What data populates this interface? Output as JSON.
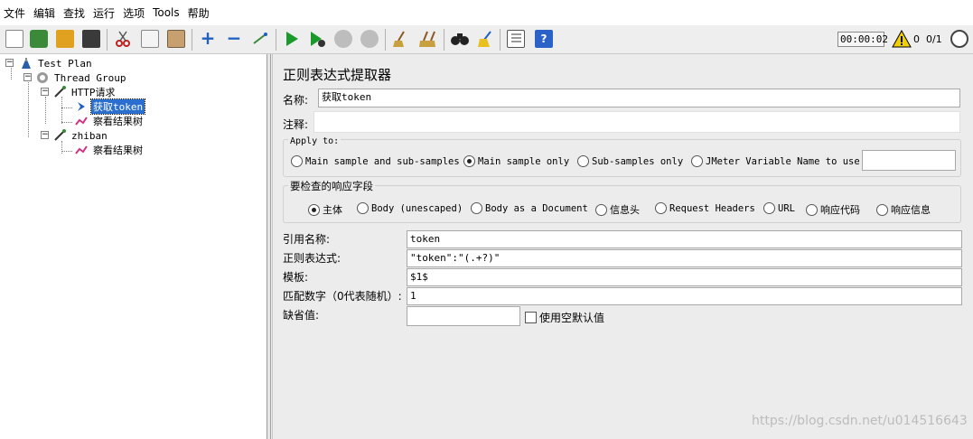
{
  "menu": [
    "文件",
    "编辑",
    "查找",
    "运行",
    "选项",
    "Tools",
    "帮助"
  ],
  "toolbar": {
    "icons": [
      "new-icon",
      "templates-icon",
      "open-icon",
      "save-icon",
      "cut-icon",
      "copy-icon",
      "paste-icon",
      "expand-icon",
      "collapse-icon",
      "toggle-icon",
      "start-icon",
      "start-no-pause-icon",
      "stop-icon",
      "shutdown-icon",
      "clear-icon",
      "clear-all-icon",
      "search-icon",
      "reset-search-icon",
      "function-helper-icon",
      "help-icon"
    ],
    "timer": "00:00:02",
    "warning_count": "0",
    "threads": "0/1"
  },
  "tree": {
    "items": [
      {
        "label": "Test Plan"
      },
      {
        "label": "Thread Group"
      },
      {
        "label": "HTTP请求"
      },
      {
        "label": "获取token"
      },
      {
        "label": "察看结果树"
      },
      {
        "label": "zhiban"
      },
      {
        "label": "察看结果树"
      }
    ]
  },
  "panel": {
    "title": "正则表达式提取器",
    "name_label": "名称:",
    "name_value": "获取token",
    "comment_label": "注释:",
    "comment_value": "",
    "apply_to": {
      "label": "Apply to:",
      "options": [
        "Main sample and sub-samples",
        "Main sample only",
        "Sub-samples only",
        "JMeter Variable Name to use"
      ],
      "selected": "Main sample only",
      "variable_value": ""
    },
    "field_to_check": {
      "label": "要检查的响应字段",
      "options": [
        "主体",
        "Body (unescaped)",
        "Body as a Document",
        "信息头",
        "Request Headers",
        "URL",
        "响应代码",
        "响应信息"
      ],
      "selected": "主体"
    },
    "ref_name_label": "引用名称:",
    "ref_name_value": "token",
    "regex_label": "正则表达式:",
    "regex_value": "\"token\":\"(.+?)\"",
    "template_label": "模板:",
    "template_value": "$1$",
    "match_no_label": "匹配数字（0代表随机）:",
    "match_no_value": "1",
    "default_label": "缺省值:",
    "default_value": "",
    "use_empty_default_label": "使用空默认值"
  },
  "watermark": "https://blog.csdn.net/u014516643",
  "colors": {
    "selection": "#2a6fd0",
    "start_green": "#1a9a2a",
    "accent_blue": "#2060c0"
  }
}
